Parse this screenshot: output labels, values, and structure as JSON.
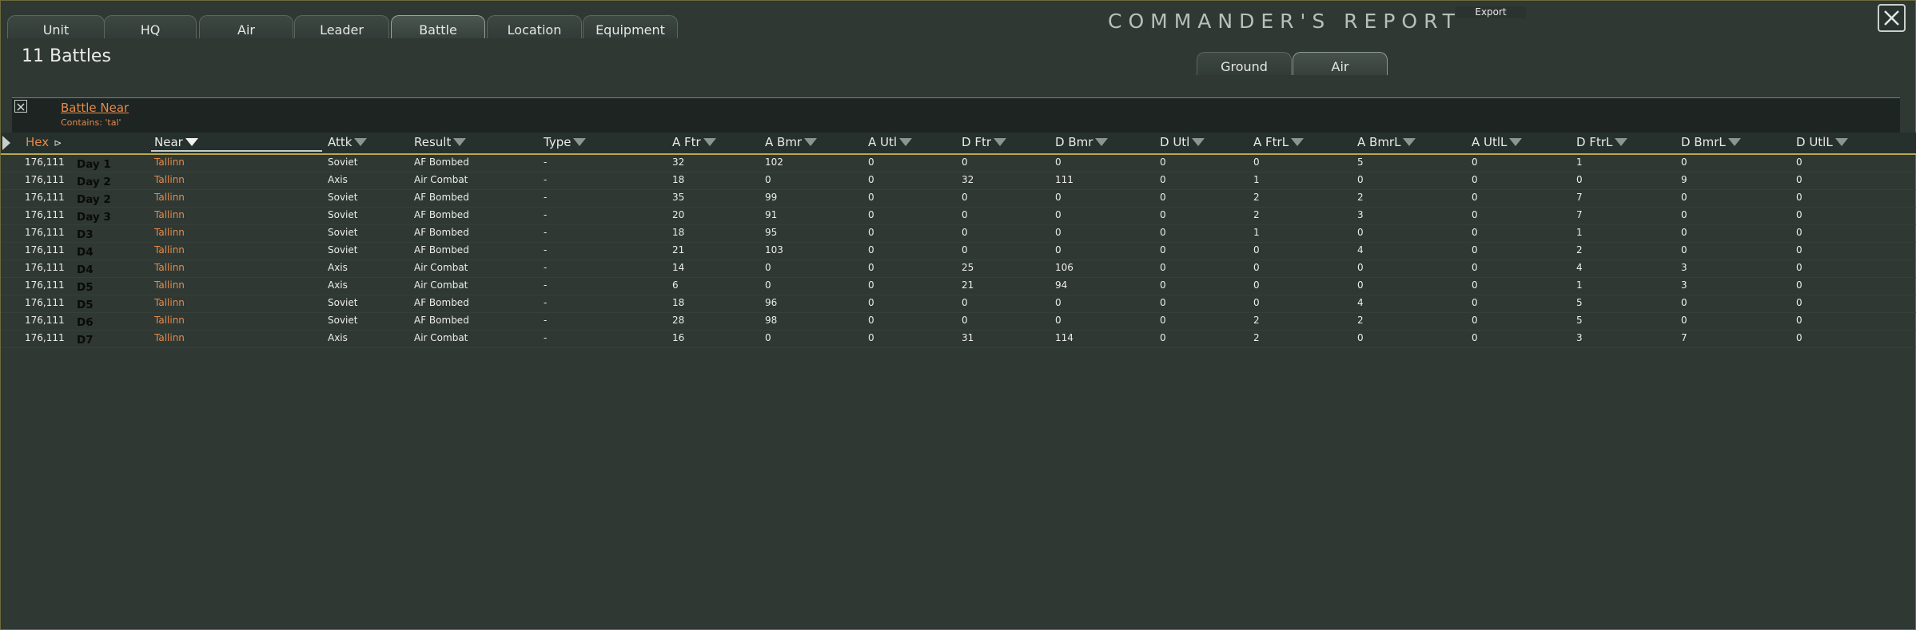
{
  "tabs": [
    "Unit",
    "HQ",
    "Air",
    "Leader",
    "Battle",
    "Location",
    "Equipment"
  ],
  "active_tab": "Battle",
  "title": "COMMANDER'S REPORT",
  "export_label": "Export",
  "battles_count": "11 Battles",
  "sub_tabs": [
    "Ground",
    "Air"
  ],
  "active_sub_tab": "Air",
  "filter": {
    "name": "Battle Near",
    "description": "Contains: 'tal'"
  },
  "columns": [
    "Hex",
    "Near",
    "Attk",
    "Result",
    "Type",
    "A Ftr",
    "A Bmr",
    "A Utl",
    "D Ftr",
    "D Bmr",
    "D Utl",
    "A FtrL",
    "A BmrL",
    "A UtlL",
    "D FtrL",
    "D BmrL",
    "D UtlL"
  ],
  "rows": [
    {
      "hex": "176,111",
      "day": "Day 1",
      "near": "Tallinn",
      "attk": "Soviet",
      "result": "AF Bombed",
      "type": "-",
      "a_ftr": "32",
      "a_bmr": "102",
      "a_utl": "0",
      "d_ftr": "0",
      "d_bmr": "0",
      "d_utl": "0",
      "a_ftrl": "0",
      "a_bmrl": "5",
      "a_utll": "0",
      "d_ftrl": "1",
      "d_bmrl": "0",
      "d_utll": "0"
    },
    {
      "hex": "176,111",
      "day": "Day 2",
      "near": "Tallinn",
      "attk": "Axis",
      "result": "Air Combat",
      "type": "-",
      "a_ftr": "18",
      "a_bmr": "0",
      "a_utl": "0",
      "d_ftr": "32",
      "d_bmr": "111",
      "d_utl": "0",
      "a_ftrl": "1",
      "a_bmrl": "0",
      "a_utll": "0",
      "d_ftrl": "0",
      "d_bmrl": "9",
      "d_utll": "0"
    },
    {
      "hex": "176,111",
      "day": "Day 2",
      "near": "Tallinn",
      "attk": "Soviet",
      "result": "AF Bombed",
      "type": "-",
      "a_ftr": "35",
      "a_bmr": "99",
      "a_utl": "0",
      "d_ftr": "0",
      "d_bmr": "0",
      "d_utl": "0",
      "a_ftrl": "2",
      "a_bmrl": "2",
      "a_utll": "0",
      "d_ftrl": "7",
      "d_bmrl": "0",
      "d_utll": "0"
    },
    {
      "hex": "176,111",
      "day": "Day 3",
      "near": "Tallinn",
      "attk": "Soviet",
      "result": "AF Bombed",
      "type": "-",
      "a_ftr": "20",
      "a_bmr": "91",
      "a_utl": "0",
      "d_ftr": "0",
      "d_bmr": "0",
      "d_utl": "0",
      "a_ftrl": "2",
      "a_bmrl": "3",
      "a_utll": "0",
      "d_ftrl": "7",
      "d_bmrl": "0",
      "d_utll": "0"
    },
    {
      "hex": "176,111",
      "day": "D3",
      "near": "Tallinn",
      "attk": "Soviet",
      "result": "AF Bombed",
      "type": "-",
      "a_ftr": "18",
      "a_bmr": "95",
      "a_utl": "0",
      "d_ftr": "0",
      "d_bmr": "0",
      "d_utl": "0",
      "a_ftrl": "1",
      "a_bmrl": "0",
      "a_utll": "0",
      "d_ftrl": "1",
      "d_bmrl": "0",
      "d_utll": "0"
    },
    {
      "hex": "176,111",
      "day": "D4",
      "near": "Tallinn",
      "attk": "Soviet",
      "result": "AF Bombed",
      "type": "-",
      "a_ftr": "21",
      "a_bmr": "103",
      "a_utl": "0",
      "d_ftr": "0",
      "d_bmr": "0",
      "d_utl": "0",
      "a_ftrl": "0",
      "a_bmrl": "4",
      "a_utll": "0",
      "d_ftrl": "2",
      "d_bmrl": "0",
      "d_utll": "0"
    },
    {
      "hex": "176,111",
      "day": "D4",
      "near": "Tallinn",
      "attk": "Axis",
      "result": "Air Combat",
      "type": "-",
      "a_ftr": "14",
      "a_bmr": "0",
      "a_utl": "0",
      "d_ftr": "25",
      "d_bmr": "106",
      "d_utl": "0",
      "a_ftrl": "0",
      "a_bmrl": "0",
      "a_utll": "0",
      "d_ftrl": "4",
      "d_bmrl": "3",
      "d_utll": "0"
    },
    {
      "hex": "176,111",
      "day": "D5",
      "near": "Tallinn",
      "attk": "Axis",
      "result": "Air Combat",
      "type": "-",
      "a_ftr": "6",
      "a_bmr": "0",
      "a_utl": "0",
      "d_ftr": "21",
      "d_bmr": "94",
      "d_utl": "0",
      "a_ftrl": "0",
      "a_bmrl": "0",
      "a_utll": "0",
      "d_ftrl": "1",
      "d_bmrl": "3",
      "d_utll": "0"
    },
    {
      "hex": "176,111",
      "day": "D5",
      "near": "Tallinn",
      "attk": "Soviet",
      "result": "AF Bombed",
      "type": "-",
      "a_ftr": "18",
      "a_bmr": "96",
      "a_utl": "0",
      "d_ftr": "0",
      "d_bmr": "0",
      "d_utl": "0",
      "a_ftrl": "0",
      "a_bmrl": "4",
      "a_utll": "0",
      "d_ftrl": "5",
      "d_bmrl": "0",
      "d_utll": "0"
    },
    {
      "hex": "176,111",
      "day": "D6",
      "near": "Tallinn",
      "attk": "Soviet",
      "result": "AF Bombed",
      "type": "-",
      "a_ftr": "28",
      "a_bmr": "98",
      "a_utl": "0",
      "d_ftr": "0",
      "d_bmr": "0",
      "d_utl": "0",
      "a_ftrl": "2",
      "a_bmrl": "2",
      "a_utll": "0",
      "d_ftrl": "5",
      "d_bmrl": "0",
      "d_utll": "0"
    },
    {
      "hex": "176,111",
      "day": "D7",
      "near": "Tallinn",
      "attk": "Axis",
      "result": "Air Combat",
      "type": "-",
      "a_ftr": "16",
      "a_bmr": "0",
      "a_utl": "0",
      "d_ftr": "31",
      "d_bmr": "114",
      "d_utl": "0",
      "a_ftrl": "2",
      "a_bmrl": "0",
      "a_utll": "0",
      "d_ftrl": "3",
      "d_bmrl": "7",
      "d_utll": "0"
    }
  ]
}
